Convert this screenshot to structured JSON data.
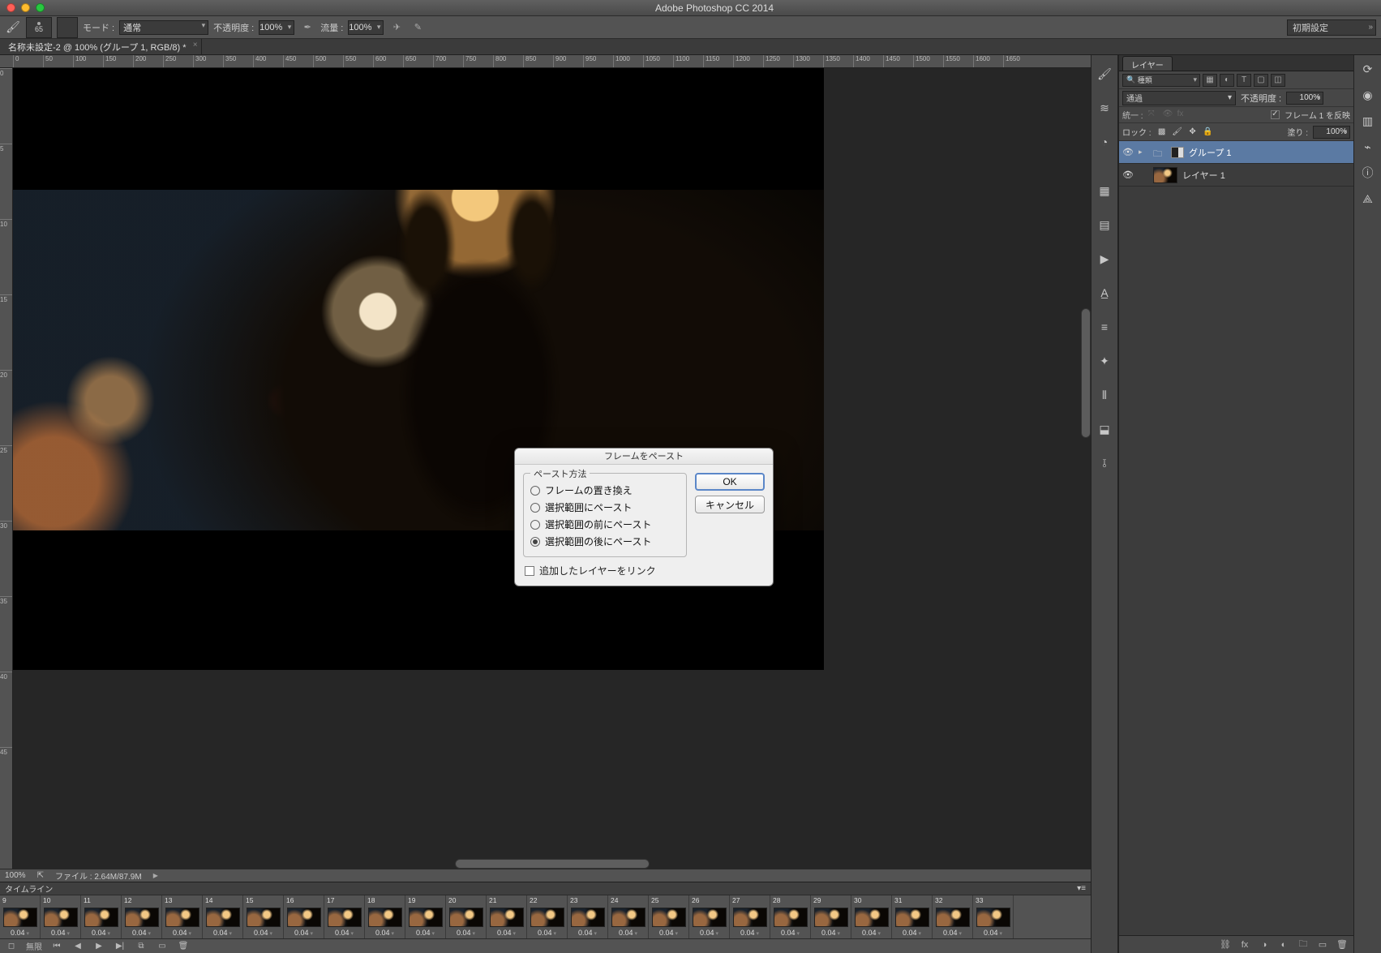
{
  "app_title": "Adobe Photoshop CC 2014",
  "options_bar": {
    "brush_size": "65",
    "mode_label": "モード :",
    "mode_value": "通常",
    "opacity_label": "不透明度 :",
    "opacity_value": "100%",
    "flow_label": "流量 :",
    "flow_value": "100%"
  },
  "workspace_selector": "初期設定",
  "document_tab": "名称未設定-2 @ 100% (グループ 1, RGB/8) *",
  "ruler_h_ticks": [
    "0",
    "50",
    "100",
    "150",
    "200",
    "250",
    "300",
    "350",
    "400",
    "450",
    "500",
    "550",
    "600",
    "650",
    "700",
    "750",
    "800",
    "850",
    "900",
    "950",
    "1000",
    "1050",
    "1100",
    "1150",
    "1200",
    "1250",
    "1300",
    "1350",
    "1400",
    "1450",
    "1500",
    "1550",
    "1600",
    "1650"
  ],
  "ruler_v_ticks": [
    "0",
    "5",
    "10",
    "15",
    "20",
    "25",
    "30",
    "35",
    "40",
    "45"
  ],
  "status_bar": {
    "zoom": "100%",
    "file_label": "ファイル :",
    "file_value": "2.64M/87.9M"
  },
  "timeline": {
    "panel_title": "タイムライン",
    "frames": [
      {
        "n": "9",
        "t": "0.04"
      },
      {
        "n": "10",
        "t": "0.04"
      },
      {
        "n": "11",
        "t": "0.04"
      },
      {
        "n": "12",
        "t": "0.04"
      },
      {
        "n": "13",
        "t": "0.04"
      },
      {
        "n": "14",
        "t": "0.04"
      },
      {
        "n": "15",
        "t": "0.04"
      },
      {
        "n": "16",
        "t": "0.04"
      },
      {
        "n": "17",
        "t": "0.04"
      },
      {
        "n": "18",
        "t": "0.04"
      },
      {
        "n": "19",
        "t": "0.04"
      },
      {
        "n": "20",
        "t": "0.04"
      },
      {
        "n": "21",
        "t": "0.04"
      },
      {
        "n": "22",
        "t": "0.04"
      },
      {
        "n": "23",
        "t": "0.04"
      },
      {
        "n": "24",
        "t": "0.04"
      },
      {
        "n": "25",
        "t": "0.04"
      },
      {
        "n": "26",
        "t": "0.04"
      },
      {
        "n": "27",
        "t": "0.04"
      },
      {
        "n": "28",
        "t": "0.04"
      },
      {
        "n": "29",
        "t": "0.04"
      },
      {
        "n": "30",
        "t": "0.04"
      },
      {
        "n": "31",
        "t": "0.04"
      },
      {
        "n": "32",
        "t": "0.04"
      },
      {
        "n": "33",
        "t": "0.04"
      }
    ],
    "loop_label": "無限"
  },
  "layers_panel": {
    "tab": "レイヤー",
    "filter_kind": "種類",
    "blend_mode": "通過",
    "opacity_label": "不透明度 :",
    "opacity_value": "100%",
    "unify_label": "統一 :",
    "propagate_label": "フレーム 1 を反映",
    "lock_label": "ロック :",
    "fill_label": "塗り :",
    "fill_value": "100%",
    "rows": [
      {
        "name": "グループ 1",
        "type": "group",
        "selected": true
      },
      {
        "name": "レイヤー 1",
        "type": "layer",
        "selected": false
      }
    ]
  },
  "dialog": {
    "title": "フレームをペースト",
    "legend": "ペースト方法",
    "options": [
      {
        "label": "フレームの置き換え",
        "on": false
      },
      {
        "label": "選択範囲にペースト",
        "on": false
      },
      {
        "label": "選択範囲の前にペースト",
        "on": false
      },
      {
        "label": "選択範囲の後にペースト",
        "on": true
      }
    ],
    "link_checkbox": "追加したレイヤーをリンク",
    "ok": "OK",
    "cancel": "キャンセル"
  }
}
